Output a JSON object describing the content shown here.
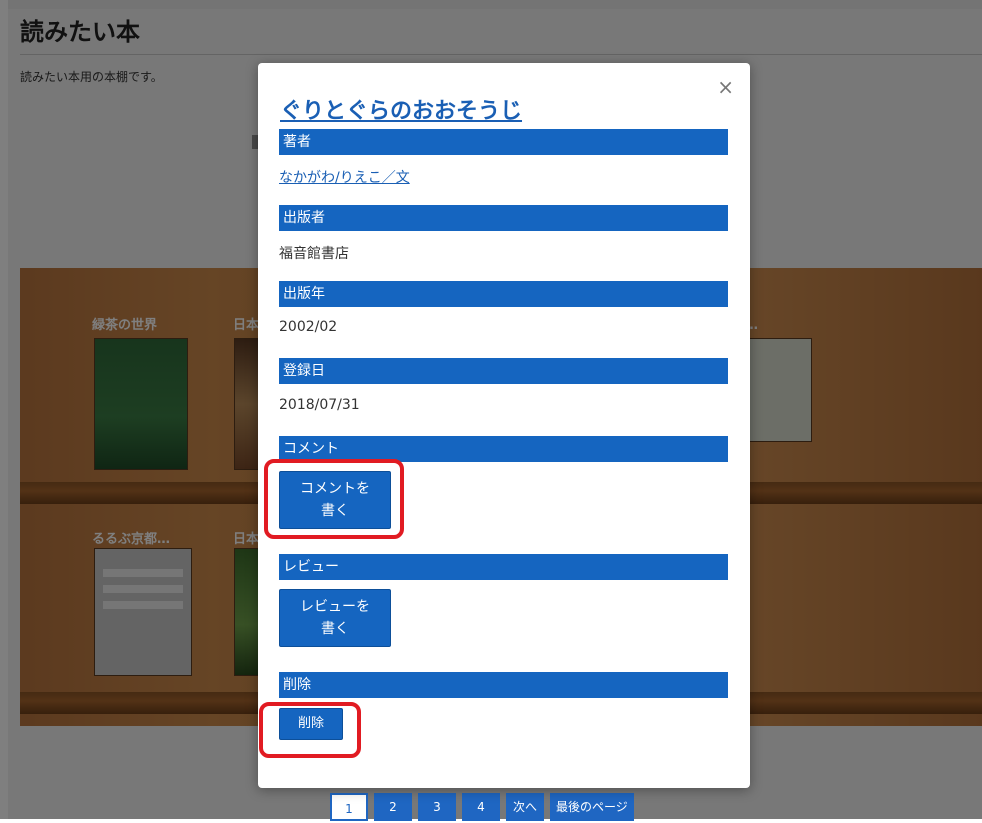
{
  "background_page": {
    "title": "読みたい本",
    "description": "読みたい本用の本棚です。",
    "books": [
      "緑茶の世界",
      "日本",
      "るるぶ京都…",
      "日本"
    ],
    "partial_title_fragment": "ら…"
  },
  "pagination": [
    "1",
    "2",
    "3",
    "4",
    "次へ",
    "最後のページ"
  ],
  "modal": {
    "close": "×",
    "title": "ぐりとぐらのおおそうじ",
    "sections": {
      "author": {
        "label": "著者",
        "value": "なかがわ/りえこ／文"
      },
      "publisher": {
        "label": "出版者",
        "value": "福音館書店"
      },
      "year": {
        "label": "出版年",
        "value": "2002/02"
      },
      "registered": {
        "label": "登録日",
        "value": "2018/07/31"
      },
      "comment": {
        "label": "コメント",
        "button_line1": "コメントを",
        "button_line2": "書く"
      },
      "review": {
        "label": "レビュー",
        "button_line1": "レビューを",
        "button_line2": "書く"
      },
      "delete": {
        "label": "削除",
        "button": "削除"
      }
    }
  },
  "colors": {
    "accent": "#1565c0",
    "highlight": "#e11b22",
    "link": "#1a5fb4"
  }
}
